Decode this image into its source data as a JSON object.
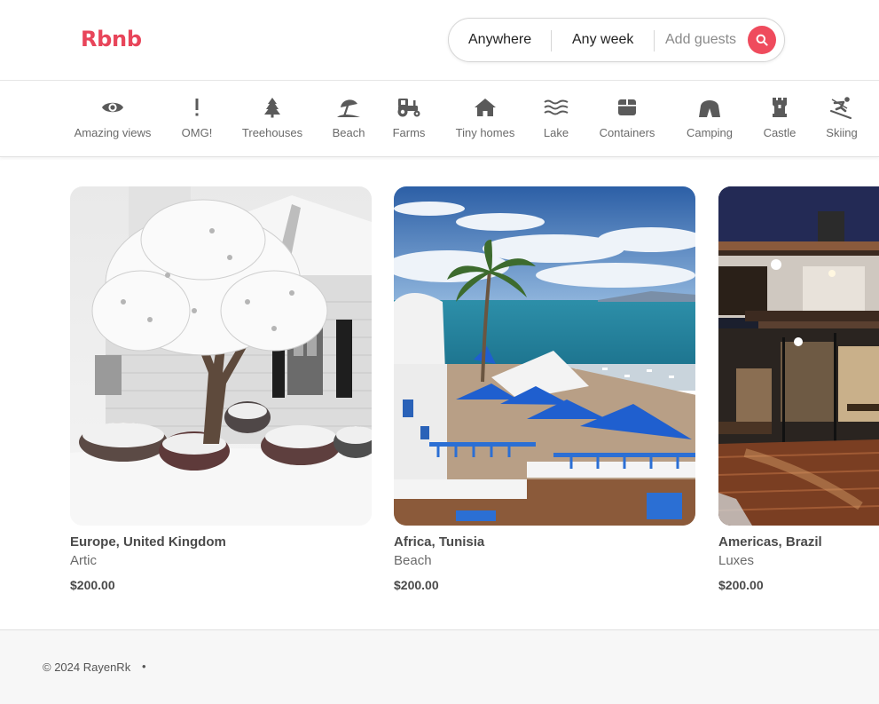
{
  "header": {
    "logo": "Rbnb",
    "search": {
      "anywhere": "Anywhere",
      "week": "Any week",
      "guests": "Add guests"
    }
  },
  "categories": [
    {
      "label": "Amazing views",
      "icon": "eye-icon"
    },
    {
      "label": "OMG!",
      "icon": "exclamation-icon"
    },
    {
      "label": "Treehouses",
      "icon": "tree-icon"
    },
    {
      "label": "Beach",
      "icon": "umbrella-icon"
    },
    {
      "label": "Farms",
      "icon": "tractor-icon"
    },
    {
      "label": "Tiny homes",
      "icon": "house-icon"
    },
    {
      "label": "Lake",
      "icon": "water-icon"
    },
    {
      "label": "Containers",
      "icon": "container-icon"
    },
    {
      "label": "Camping",
      "icon": "tent-icon"
    },
    {
      "label": "Castle",
      "icon": "castle-icon"
    },
    {
      "label": "Skiing",
      "icon": "skiing-icon"
    }
  ],
  "listings": [
    {
      "place": "Europe, United Kingdom",
      "type": "Artic",
      "price": "$200.00"
    },
    {
      "place": "Africa, Tunisia",
      "type": "Beach",
      "price": "$200.00"
    },
    {
      "place": "Americas, Brazil",
      "type": "Luxes",
      "price": "$200.00"
    }
  ],
  "footer": {
    "copyright": "© 2024 RayenRk",
    "separator": "•"
  },
  "colors": {
    "brand": "#e8455a",
    "search_button": "#ef4b5d",
    "category_icon": "#5a5a5a"
  }
}
